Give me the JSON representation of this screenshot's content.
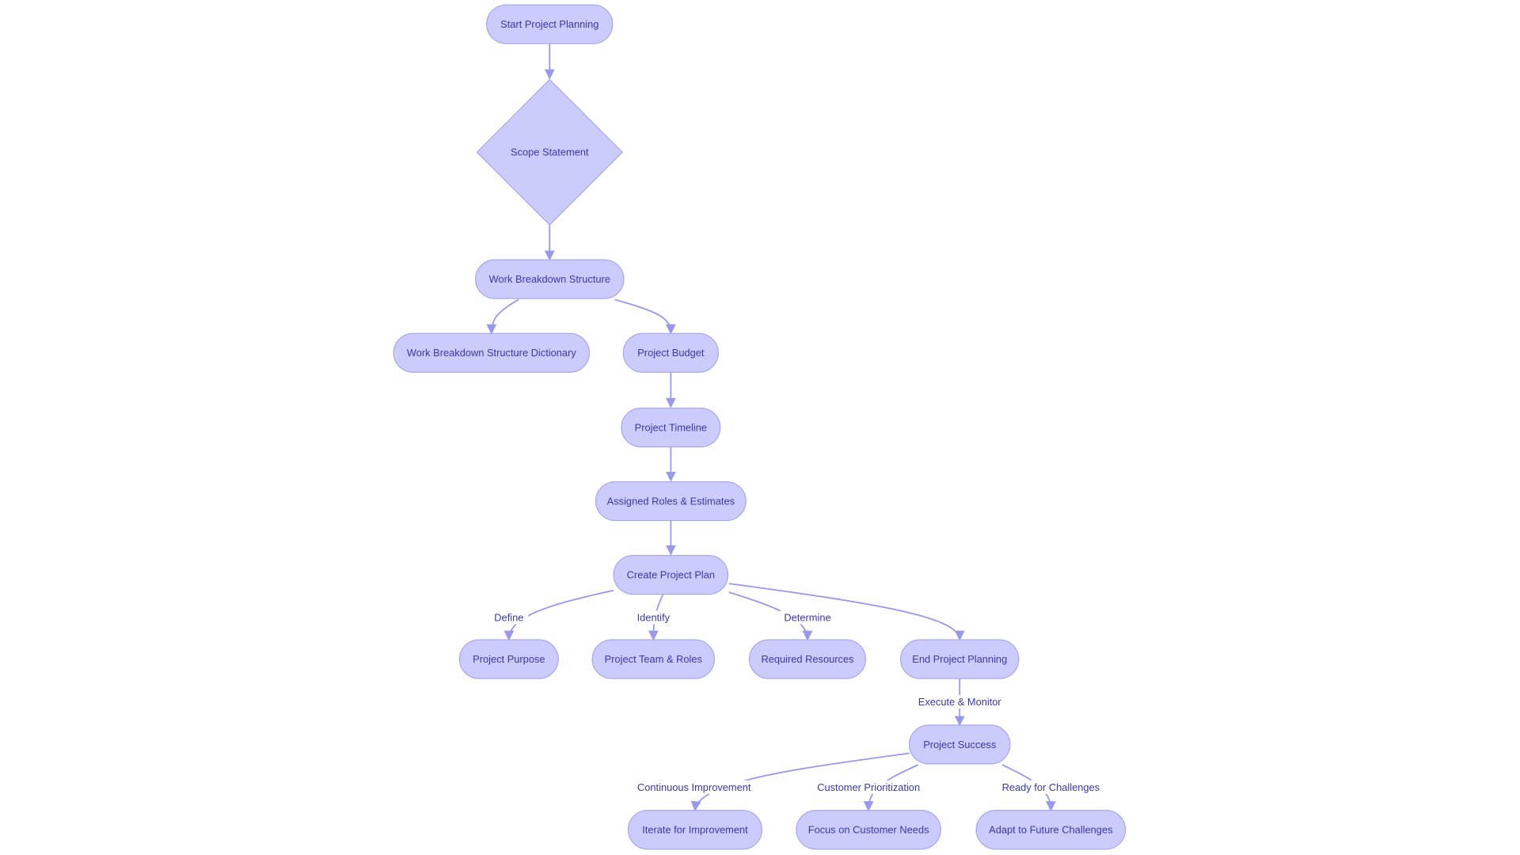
{
  "diagram": {
    "type": "flowchart",
    "colors": {
      "node_fill": "#cbcbfc",
      "node_stroke": "#a8a8ee",
      "edge": "#9999e8",
      "text": "#3838a8"
    },
    "nodes": [
      {
        "id": "start",
        "label": "Start Project Planning",
        "shape": "stadium"
      },
      {
        "id": "scope",
        "label": "Scope Statement",
        "shape": "diamond"
      },
      {
        "id": "wbs",
        "label": "Work Breakdown Structure",
        "shape": "stadium"
      },
      {
        "id": "wbsd",
        "label": "Work Breakdown Structure Dictionary",
        "shape": "stadium"
      },
      {
        "id": "budget",
        "label": "Project Budget",
        "shape": "stadium"
      },
      {
        "id": "timeline",
        "label": "Project Timeline",
        "shape": "stadium"
      },
      {
        "id": "roles",
        "label": "Assigned Roles & Estimates",
        "shape": "stadium"
      },
      {
        "id": "plan",
        "label": "Create Project Plan",
        "shape": "stadium"
      },
      {
        "id": "purpose",
        "label": "Project Purpose",
        "shape": "stadium"
      },
      {
        "id": "team",
        "label": "Project Team & Roles",
        "shape": "stadium"
      },
      {
        "id": "resources",
        "label": "Required Resources",
        "shape": "stadium"
      },
      {
        "id": "end",
        "label": "End Project Planning",
        "shape": "stadium"
      },
      {
        "id": "success",
        "label": "Project Success",
        "shape": "stadium"
      },
      {
        "id": "iterate",
        "label": "Iterate for Improvement",
        "shape": "stadium"
      },
      {
        "id": "focus",
        "label": "Focus on Customer Needs",
        "shape": "stadium"
      },
      {
        "id": "adapt",
        "label": "Adapt to Future Challenges",
        "shape": "stadium"
      }
    ],
    "edges": [
      {
        "from": "start",
        "to": "scope",
        "label": ""
      },
      {
        "from": "scope",
        "to": "wbs",
        "label": ""
      },
      {
        "from": "wbs",
        "to": "wbsd",
        "label": ""
      },
      {
        "from": "wbs",
        "to": "budget",
        "label": ""
      },
      {
        "from": "budget",
        "to": "timeline",
        "label": ""
      },
      {
        "from": "timeline",
        "to": "roles",
        "label": ""
      },
      {
        "from": "roles",
        "to": "plan",
        "label": ""
      },
      {
        "from": "plan",
        "to": "purpose",
        "label": "Define"
      },
      {
        "from": "plan",
        "to": "team",
        "label": "Identify"
      },
      {
        "from": "plan",
        "to": "resources",
        "label": "Determine"
      },
      {
        "from": "plan",
        "to": "end",
        "label": ""
      },
      {
        "from": "end",
        "to": "success",
        "label": "Execute & Monitor"
      },
      {
        "from": "success",
        "to": "iterate",
        "label": "Continuous Improvement"
      },
      {
        "from": "success",
        "to": "focus",
        "label": "Customer Prioritization"
      },
      {
        "from": "success",
        "to": "adapt",
        "label": "Ready for Challenges"
      }
    ]
  }
}
